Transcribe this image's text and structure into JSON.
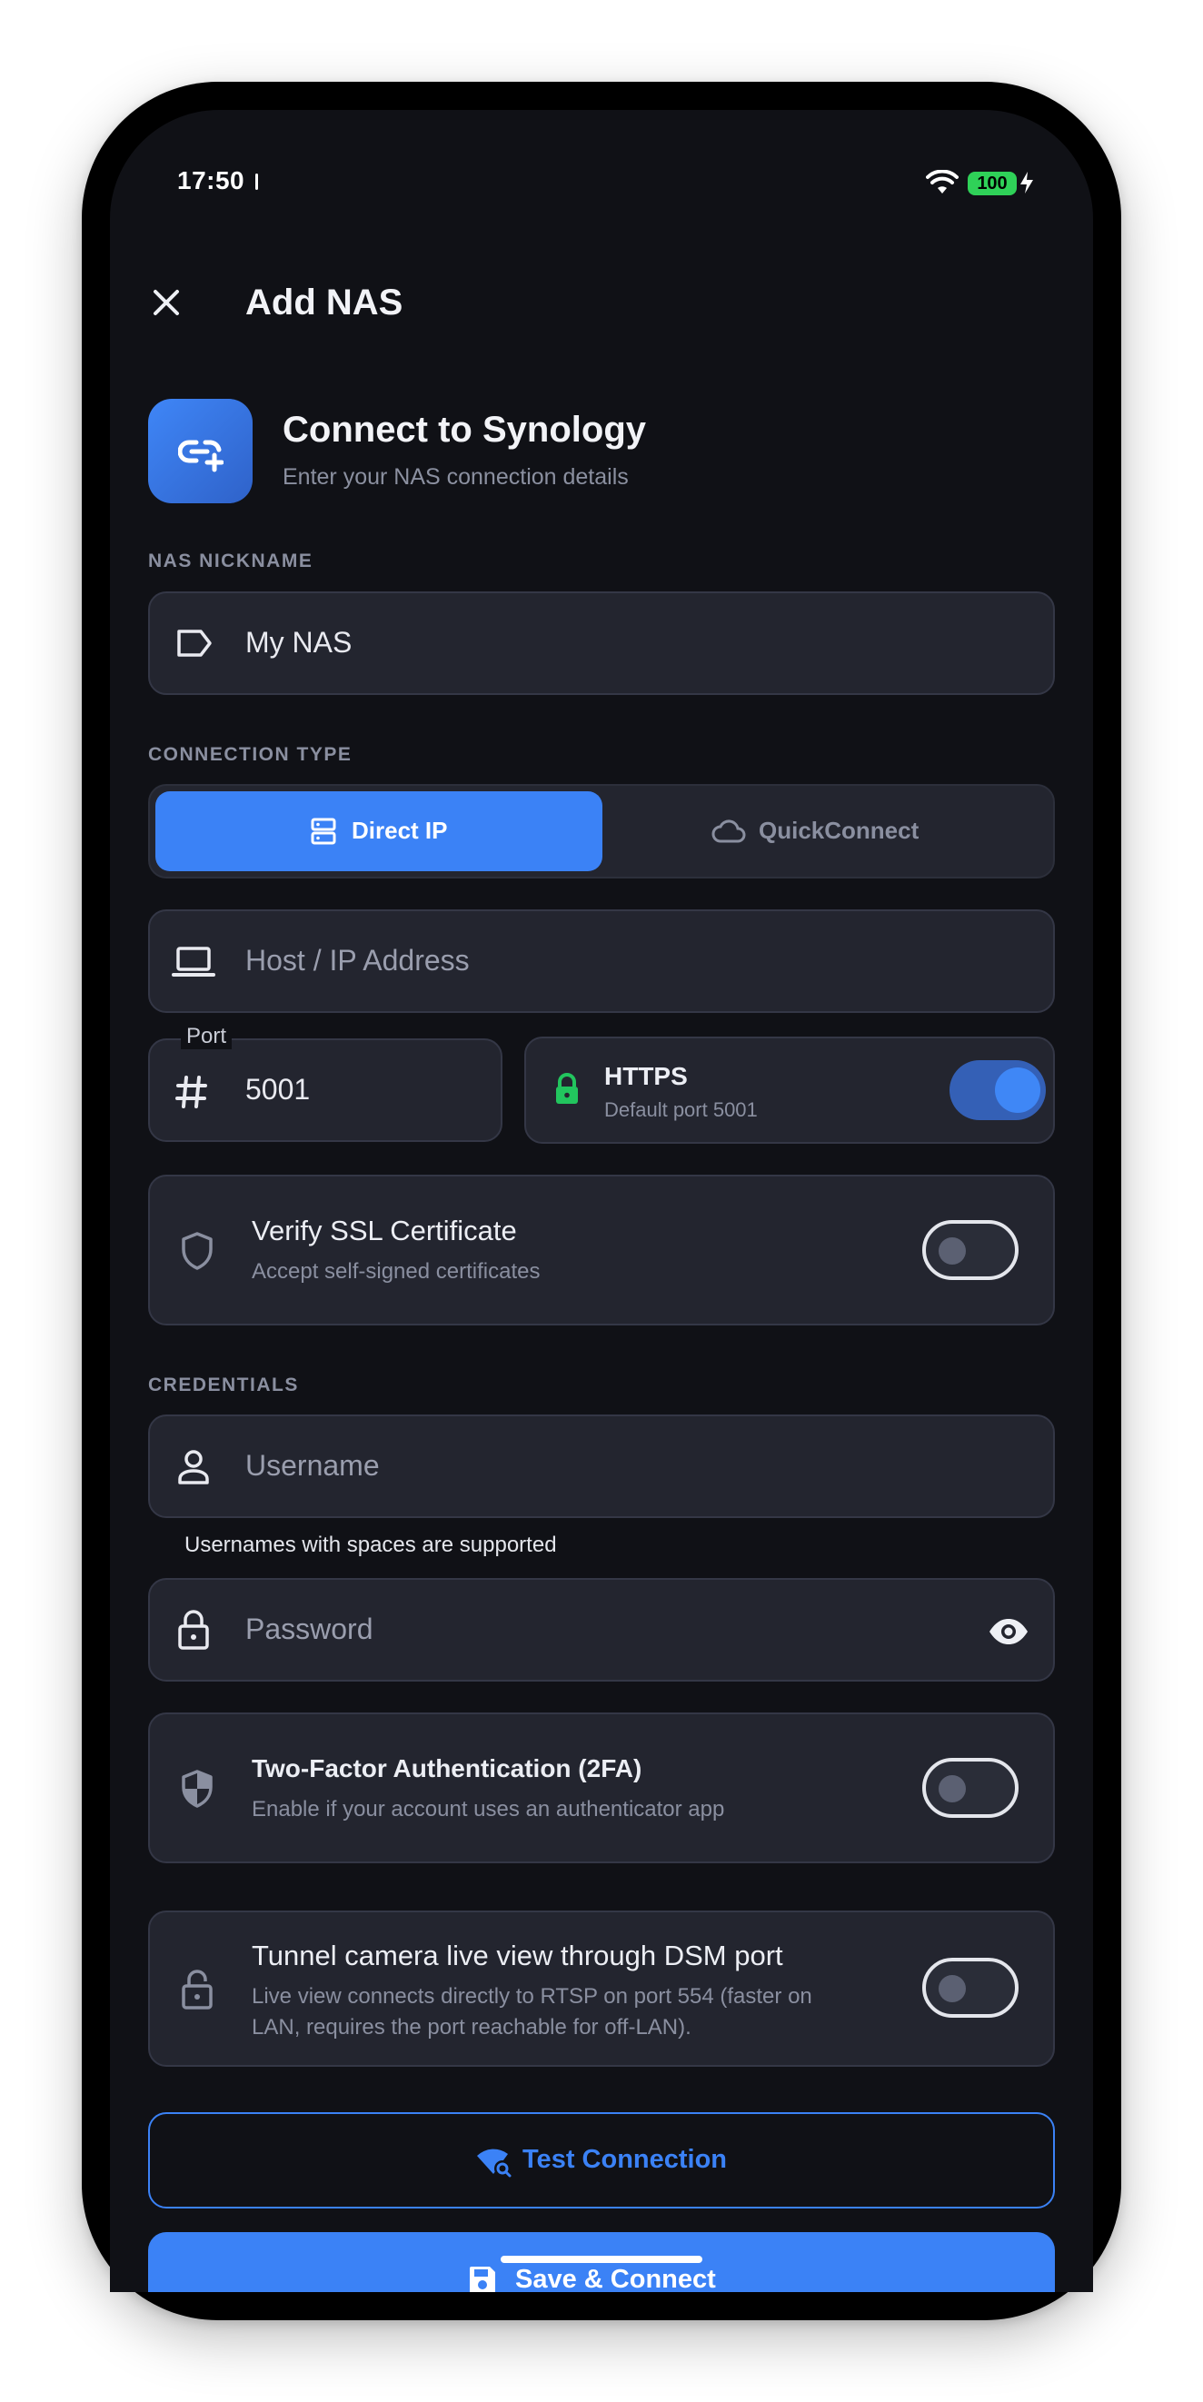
{
  "status_bar": {
    "time": "17:50",
    "battery": "100"
  },
  "header": {
    "title": "Add NAS",
    "close_icon": "close-icon"
  },
  "intro": {
    "title": "Connect to Synology",
    "subtitle": "Enter your NAS connection details",
    "icon": "link-plus-icon"
  },
  "nickname": {
    "section_label": "NAS NICKNAME",
    "value": "My NAS",
    "icon": "label-icon"
  },
  "connection_type": {
    "section_label": "CONNECTION TYPE",
    "options": [
      {
        "label": "Direct IP",
        "icon": "server-icon",
        "selected": true
      },
      {
        "label": "QuickConnect",
        "icon": "cloud-icon",
        "selected": false
      }
    ]
  },
  "host": {
    "placeholder": "Host / IP Address",
    "icon": "laptop-icon"
  },
  "port": {
    "label": "Port",
    "value": "5001",
    "icon": "hash-icon"
  },
  "https": {
    "title": "HTTPS",
    "subtitle": "Default port 5001",
    "enabled": true,
    "icon": "lock-icon",
    "accent": "#22c55e"
  },
  "ssl": {
    "title": "Verify SSL Certificate",
    "subtitle": "Accept self-signed certificates",
    "enabled": false,
    "icon": "shield-outline-icon"
  },
  "credentials": {
    "section_label": "CREDENTIALS",
    "username_placeholder": "Username",
    "username_helper": "Usernames with spaces are supported",
    "password_placeholder": "Password"
  },
  "two_factor": {
    "title": "Two-Factor Authentication (2FA)",
    "subtitle": "Enable if your account uses an authenticator app",
    "enabled": false,
    "icon": "shield-half-icon"
  },
  "tunnel": {
    "title": "Tunnel camera live view through DSM port",
    "subtitle_line1": "Live view connects directly to RTSP on port 554 (faster on",
    "subtitle_line2": "LAN, requires the port reachable for off-LAN).",
    "enabled": false,
    "icon": "lock-open-icon"
  },
  "actions": {
    "test_label": "Test Connection",
    "save_label": "Save & Connect"
  },
  "colors": {
    "accent": "#3b82f6",
    "background": "#101116",
    "surface": "#23252f"
  }
}
